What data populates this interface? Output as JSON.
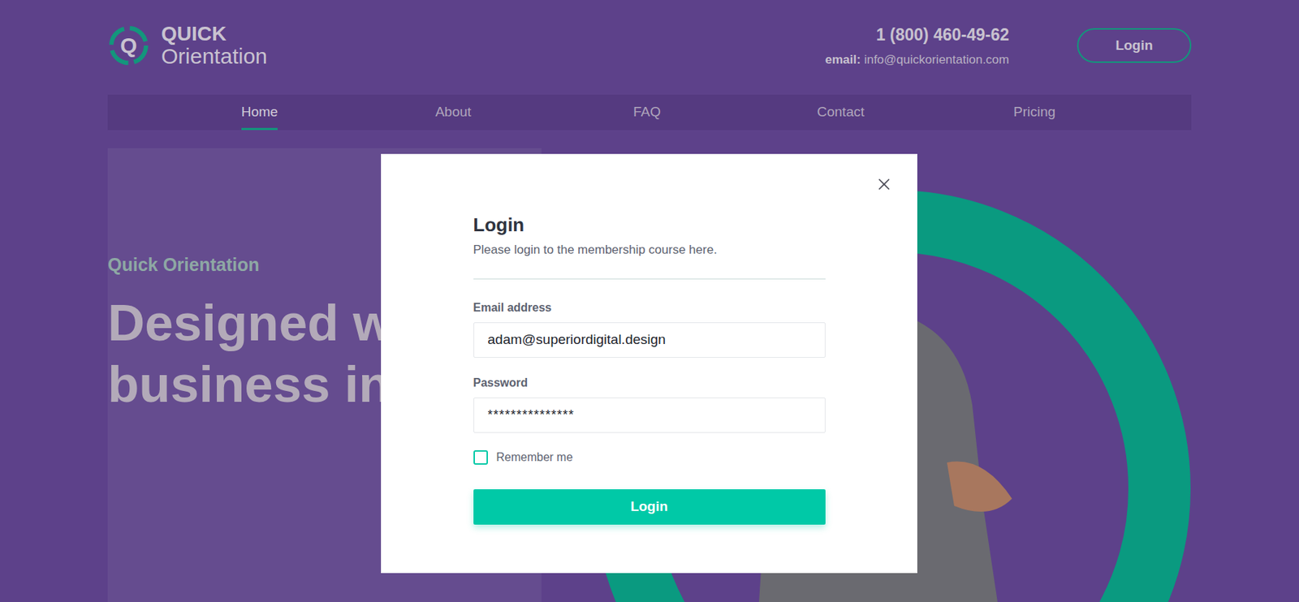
{
  "logo": {
    "mark": "Q",
    "title": "QUICK",
    "subtitle": "Orientation"
  },
  "contact": {
    "phone": "1 (800) 460-49-62",
    "email_label": "email:",
    "email": "info@quickorientation.com"
  },
  "header_button": "Login",
  "nav": [
    {
      "label": "Home",
      "selected": true
    },
    {
      "label": "About",
      "selected": false
    },
    {
      "label": "FAQ",
      "selected": false
    },
    {
      "label": "Contact",
      "selected": false
    },
    {
      "label": "Pricing",
      "selected": false
    }
  ],
  "hero": {
    "eyebrow": "Quick Orientation",
    "heading_lines": [
      "Designed w",
      "business in"
    ]
  },
  "modal": {
    "title": "Login",
    "subtitle": "Please login to the membership course here.",
    "fields": [
      {
        "label": "Email address",
        "value": "adam@superiordigital.design",
        "kind": "email"
      },
      {
        "label": "Password",
        "value": "***************",
        "kind": "password"
      }
    ],
    "remember": {
      "label": "Remember me",
      "checked": false
    },
    "submit": "Login"
  }
}
